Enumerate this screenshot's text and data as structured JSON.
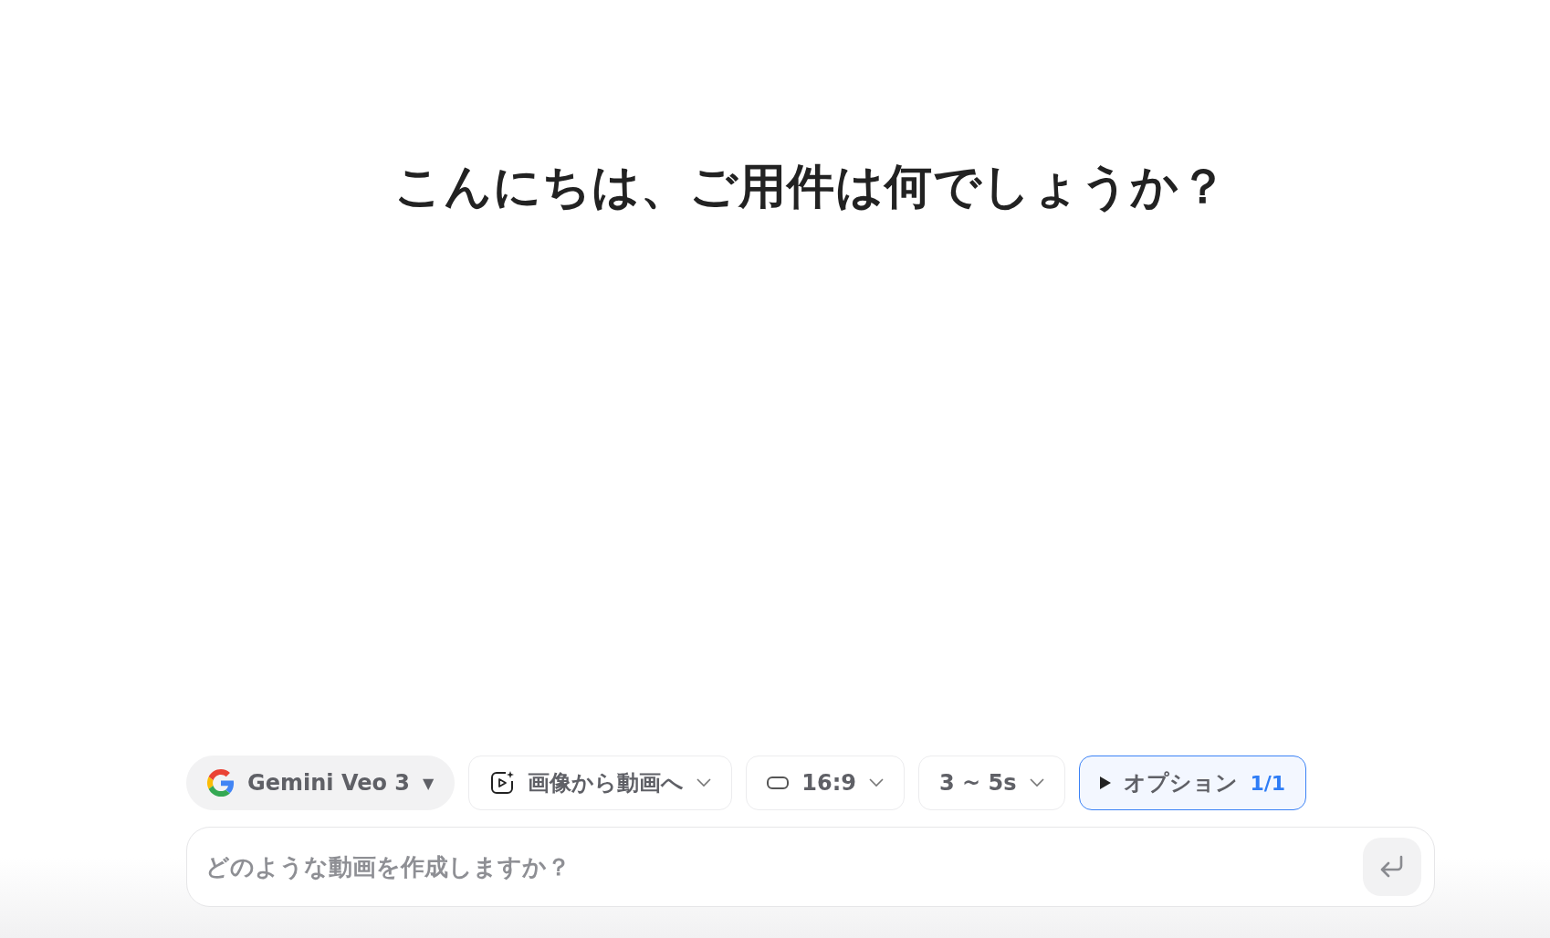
{
  "greeting": "こんにちは、ご用件は何でしょうか？",
  "toolbar": [
    {
      "kind": "model",
      "label": "Gemini Veo 3",
      "caret": "▼"
    },
    {
      "kind": "mode",
      "label": "画像から動画へ"
    },
    {
      "kind": "ratio",
      "label": "16:9"
    },
    {
      "kind": "duration",
      "label": "3 ~ 5s"
    },
    {
      "kind": "options",
      "label": "オプション",
      "count": "1/1",
      "active": true
    }
  ],
  "prompt": {
    "placeholder": "どのような動画を作成しますか？"
  }
}
